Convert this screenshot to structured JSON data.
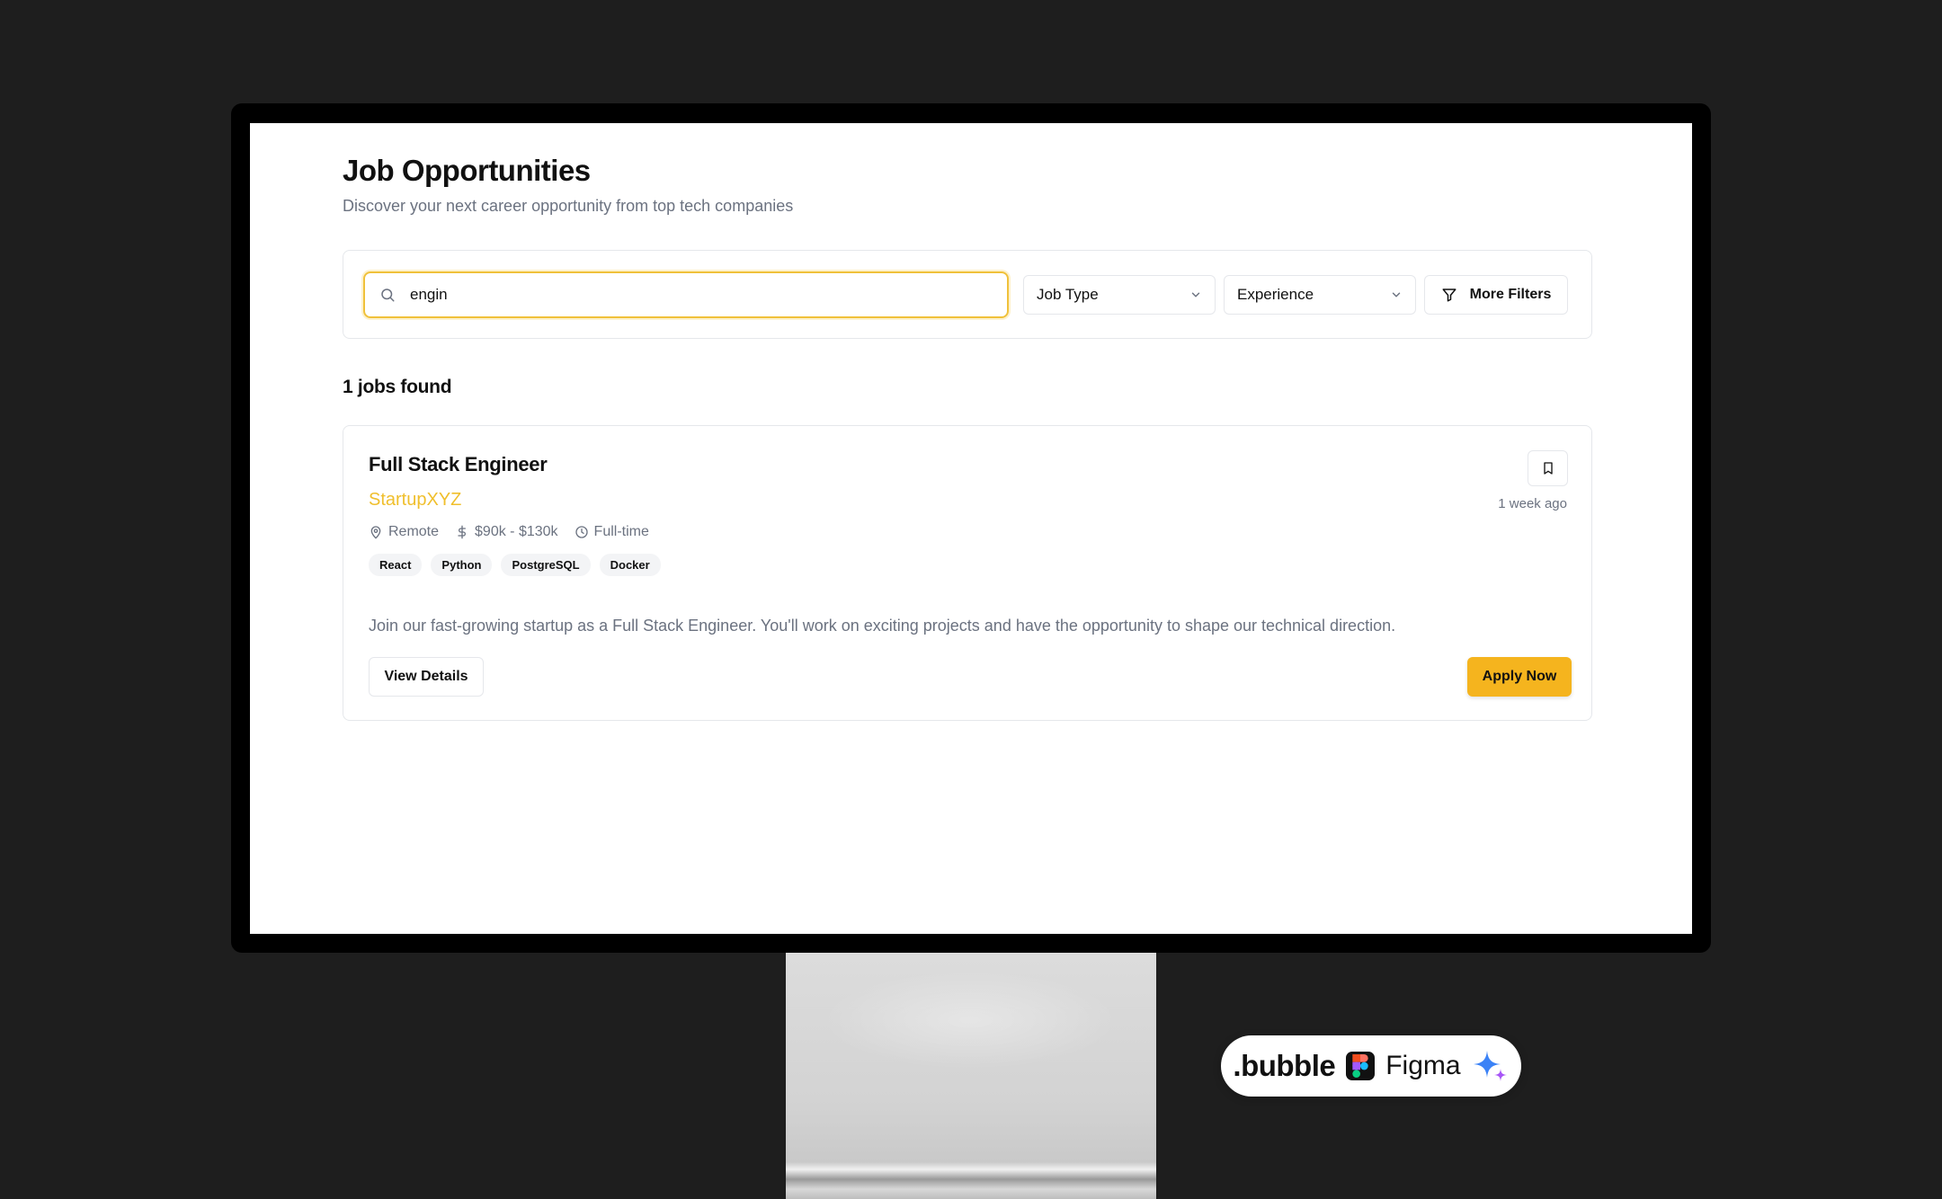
{
  "page": {
    "title": "Job Opportunities",
    "subtitle": "Discover your next career opportunity from top tech companies"
  },
  "search": {
    "value": "engin",
    "icon": "search-icon"
  },
  "filters": {
    "job_type": "Job Type",
    "experience": "Experience",
    "more_filters": "More Filters",
    "accent_color": "#f0c13a"
  },
  "results": {
    "count_text": "1 jobs found"
  },
  "jobs": [
    {
      "title": "Full Stack Engineer",
      "company": "StartupXYZ",
      "location": "Remote",
      "salary": "$90k - $130k",
      "type": "Full-time",
      "tags": [
        "React",
        "Python",
        "PostgreSQL",
        "Docker"
      ],
      "posted": "1 week ago",
      "description": "Join our fast-growing startup as a Full Stack Engineer. You'll work on exciting projects and have the opportunity to shape our technical direction.",
      "view_details": "View Details",
      "apply_now": "Apply Now"
    }
  ],
  "badge": {
    "bubble": ".bubble",
    "figma": "Figma"
  },
  "colors": {
    "company": "#f0bf2c",
    "apply_button": "#f5b41e",
    "background": "#1e1e1e"
  }
}
